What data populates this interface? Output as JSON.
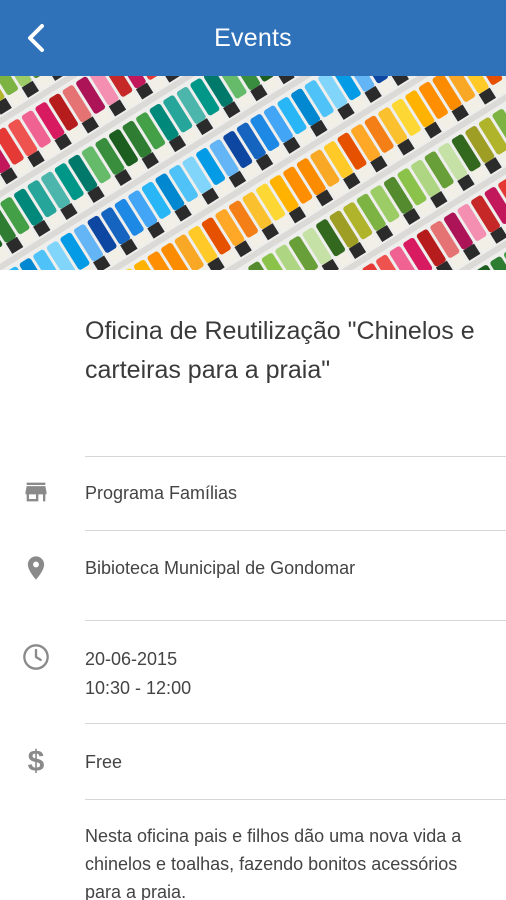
{
  "header": {
    "title": "Events"
  },
  "event": {
    "title": "Oficina de Reutilização \"Chinelos e carteiras para a praia\"",
    "program": "Programa Famílias",
    "location": "Bibioteca Municipal de Gondomar",
    "date": "20-06-2015",
    "time": "10:30 - 12:00",
    "price": "Free",
    "description": "Nesta oficina pais e filhos dão uma nova vida a chinelos e toalhas, fazendo bonitos acessórios para a praia."
  },
  "icons": {
    "back": "back-arrow-icon",
    "program": "store-icon",
    "location": "location-pin-icon",
    "time": "clock-icon",
    "price": "dollar-icon"
  },
  "colors": {
    "appbar": "#2f72ba",
    "icon": "#8a8a8a",
    "divider": "#d6d6d6"
  }
}
